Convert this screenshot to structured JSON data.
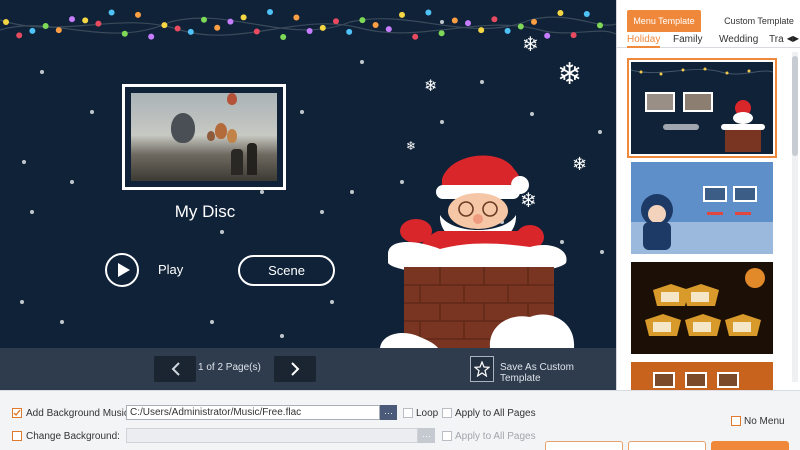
{
  "preview": {
    "disc_title": "My Disc",
    "play_label": "Play",
    "scene_label": "Scene"
  },
  "pager": {
    "page_text": "1 of 2 Page(s)",
    "save_template_label": "Save As Custom Template"
  },
  "panel": {
    "tabs": [
      "Menu Template",
      "Custom Template"
    ],
    "categories": [
      "Holiday",
      "Family",
      "Wedding",
      "Tra"
    ],
    "active_category": "Holiday",
    "thumbnail_themes": [
      "christmas-santa",
      "winter-child",
      "halloween",
      "autumn"
    ],
    "selected_thumbnail": 0
  },
  "settings": {
    "bg_music_label": "Add Background Music:",
    "bg_music_checked": true,
    "bg_music_path": "C:/Users/Administrator/Music/Free.flac",
    "loop_label": "Loop",
    "apply_all_label": "Apply to All Pages",
    "change_bg_label": "Change Background:",
    "change_bg_checked": false,
    "apply_all_label_2": "Apply to All Pages",
    "no_menu_label": "No Menu"
  },
  "colors": {
    "accent": "#f0883b",
    "canvas_bg": "#0f2238",
    "pager_bg": "#2e3c4d"
  }
}
